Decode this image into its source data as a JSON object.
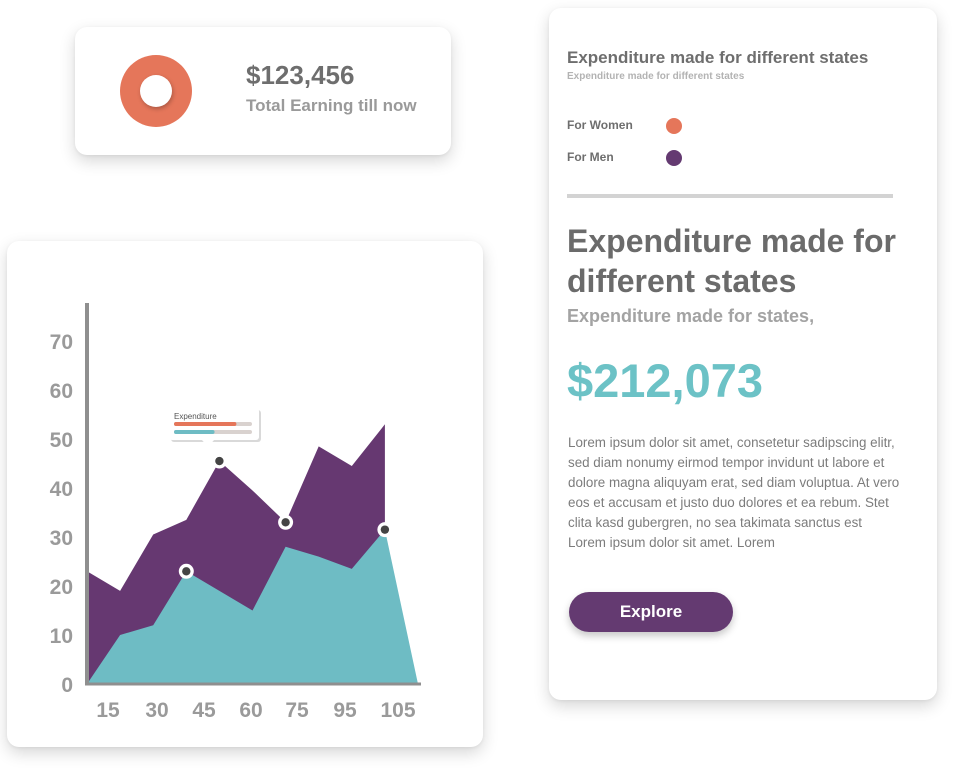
{
  "earnings": {
    "amount": "$123,456",
    "label": "Total Earning till now",
    "donut_color": "#e5765a"
  },
  "chart_data": {
    "type": "area",
    "x_ticks": [
      "15",
      "30",
      "45",
      "60",
      "75",
      "95",
      "105"
    ],
    "y_ticks": [
      "0",
      "10",
      "20",
      "30",
      "40",
      "50",
      "60",
      "70"
    ],
    "ylim": [
      0,
      70
    ],
    "series": [
      {
        "color": "#663871",
        "points": [
          [
            0,
            23
          ],
          [
            1,
            19
          ],
          [
            2,
            30.5
          ],
          [
            3,
            33.5
          ],
          [
            4,
            45.5
          ],
          [
            5,
            39.5
          ],
          [
            6,
            33
          ],
          [
            7,
            48.5
          ],
          [
            8,
            44.5
          ],
          [
            9,
            53
          ]
        ]
      },
      {
        "color": "#6ebcc4",
        "points": [
          [
            0,
            0
          ],
          [
            1,
            10
          ],
          [
            2,
            12
          ],
          [
            3,
            23
          ],
          [
            4,
            19
          ],
          [
            5,
            15
          ],
          [
            6,
            28
          ],
          [
            7,
            26
          ],
          [
            8,
            23.5
          ],
          [
            9,
            31.5
          ],
          [
            10,
            0
          ]
        ]
      }
    ],
    "markers": [
      {
        "series": 1,
        "point": 3
      },
      {
        "series": 0,
        "point": 4
      },
      {
        "series": 0,
        "point": 6
      },
      {
        "series": 1,
        "point": 9
      }
    ],
    "tooltip": {
      "label": "Expenditure",
      "bars": [
        {
          "color": "#e5765a",
          "fraction": 0.8
        },
        {
          "color": "#6ebcc4",
          "fraction": 0.52
        }
      ]
    }
  },
  "info": {
    "small_title": "Expenditure made for different states",
    "small_subtitle": "Expenditure made for different states",
    "legend": [
      {
        "label": "For Women",
        "color": "#e5765a"
      },
      {
        "label": "For Men",
        "color": "#643a71"
      }
    ],
    "big_title": "Expenditure made for different states",
    "subtitle": "Expenditure made for states,",
    "amount": "$212,073",
    "amount_color": "#6cc2c6",
    "lorem": "Lorem ipsum dolor sit amet, consetetur sadipscing elitr, sed diam nonumy eirmod tempor invidunt ut labore et dolore magna aliquyam erat, sed diam voluptua. At vero eos et accusam et justo duo dolores et ea rebum. Stet clita kasd gubergren, no sea takimata sanctus est Lorem ipsum dolor sit amet. Lorem",
    "button_label": "Explore"
  }
}
